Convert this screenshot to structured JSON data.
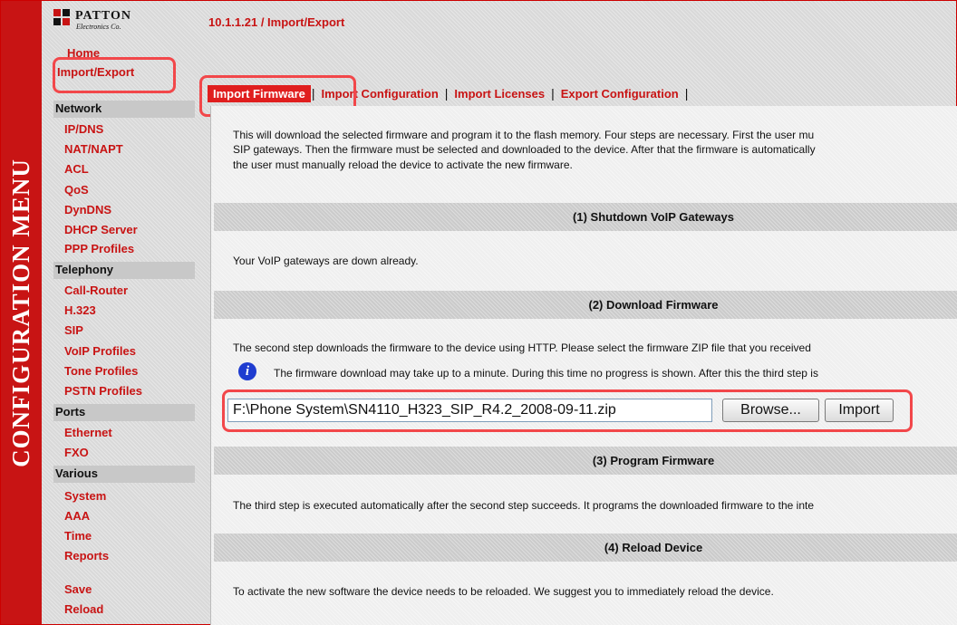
{
  "sidebar": {
    "band_text": "CONFIGURATION MENU",
    "logo": {
      "brand": "PATTON",
      "sub": "Electronics Co."
    },
    "home": "Home",
    "import_export": "Import/Export",
    "groups": [
      {
        "title": "Network",
        "items": [
          "IP/DNS",
          "NAT/NAPT",
          "ACL",
          "QoS",
          "DynDNS",
          "DHCP Server",
          "PPP Profiles"
        ]
      },
      {
        "title": "Telephony",
        "items": [
          "Call-Router",
          "H.323",
          "SIP",
          "VoIP Profiles",
          "Tone Profiles",
          "PSTN Profiles"
        ]
      },
      {
        "title": "Ports",
        "items": [
          "Ethernet",
          "FXO"
        ]
      },
      {
        "title": "Various",
        "items": [
          "System",
          "AAA",
          "Time",
          "Reports"
        ]
      }
    ],
    "save": "Save",
    "reload": "Reload"
  },
  "header": {
    "breadcrumb": "10.1.1.21 / Import/Export"
  },
  "tabs": {
    "separator": "|",
    "items": [
      "Import Firmware",
      "Import Configuration",
      "Import Licenses",
      "Export Configuration"
    ],
    "active_index": 0
  },
  "intro": {
    "line1": "This will download the selected firmware and program it to the flash memory. Four steps are necessary. First the user mu",
    "line2": "SIP gateways. Then the firmware must be selected and downloaded to the device. After that the firmware is automatically",
    "line3": "the user must manually reload the device to activate the new firmware."
  },
  "sections": [
    {
      "title": "(1) Shutdown VoIP Gateways",
      "text": "Your VoIP gateways are down already."
    },
    {
      "title": "(2) Download Firmware",
      "text": "The second step downloads the firmware to the device using HTTP. Please select the firmware ZIP file that you received"
    },
    {
      "title": "(3) Program Firmware",
      "text": "The third step is executed automatically after the second step succeeds. It programs the downloaded firmware to the inte"
    },
    {
      "title": "(4) Reload Device",
      "text": "To activate the new software the device needs to be reloaded. We suggest you to immediately reload the device."
    }
  ],
  "download": {
    "info_icon_glyph": "i",
    "note": "The firmware download may take up to a minute. During this time no progress is shown. After this the third step is",
    "file_value": "F:\\Phone System\\SN4110_H323_SIP_R4.2_2008-09-11.zip",
    "browse_label": "Browse...",
    "import_label": "Import"
  },
  "colors": {
    "accent": "#c81414",
    "highlight": "#f2474a",
    "tab_active": "#e01e1e",
    "info_blue": "#1f3cd0"
  }
}
